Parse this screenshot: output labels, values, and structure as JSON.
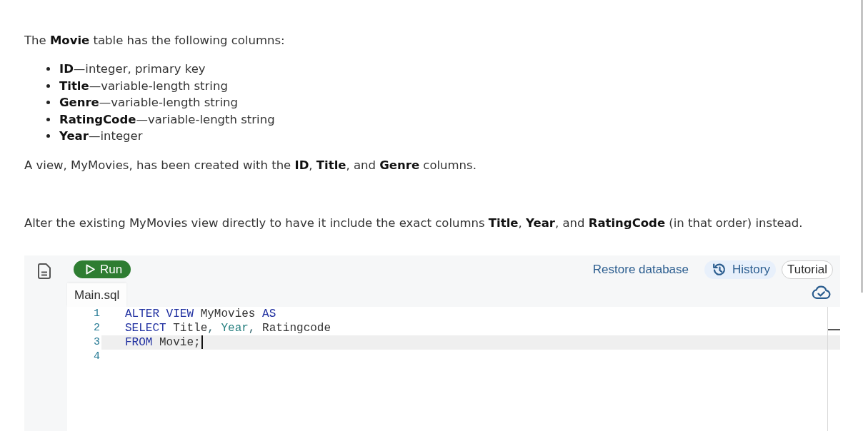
{
  "intro": "The **Movie** table has the following columns:",
  "columns": [
    "**ID**—integer, primary key",
    "**Title**—variable-length string",
    "**Genre**—variable-length string",
    "**RatingCode**—variable-length string",
    "**Year**—integer"
  ],
  "view_note": "A view, MyMovies, has been created with the **ID**, **Title**, and **Genre** columns.",
  "task": "Alter the existing MyMovies view directly to have it include the exact columns **Title**, **Year**, and **RatingCode** (in that order) instead.",
  "editor": {
    "run_button": "Run",
    "toolbar": [
      {
        "kind": "link",
        "label": "Restore database"
      },
      {
        "kind": "icon-pill",
        "label": "History"
      },
      {
        "kind": "outline-pill",
        "label": "Tutorial"
      }
    ],
    "file_tab": {
      "label": "Main.sql",
      "selected": true
    },
    "code_lines": [
      {
        "number": "1",
        "active": false,
        "tokens": [
          {
            "kind": "keyword",
            "text": "ALTER VIEW "
          },
          {
            "kind": "identifier",
            "text": "MyMovies "
          },
          {
            "kind": "keyword",
            "text": "AS"
          }
        ]
      },
      {
        "number": "2",
        "active": false,
        "tokens": [
          {
            "kind": "keyword",
            "text": "SELECT "
          },
          {
            "kind": "identifier",
            "text": "Title"
          },
          {
            "kind": "delimiter",
            "text": ", "
          },
          {
            "kind": "builtin",
            "text": "Year"
          },
          {
            "kind": "delimiter",
            "text": ", "
          },
          {
            "kind": "identifier",
            "text": "Ratingcode"
          }
        ]
      },
      {
        "number": "3",
        "active": true,
        "tokens": [
          {
            "kind": "keyword",
            "text": "FROM "
          },
          {
            "kind": "identifier",
            "text": "Movie;"
          }
        ]
      },
      {
        "number": "4",
        "active": false
      }
    ]
  }
}
